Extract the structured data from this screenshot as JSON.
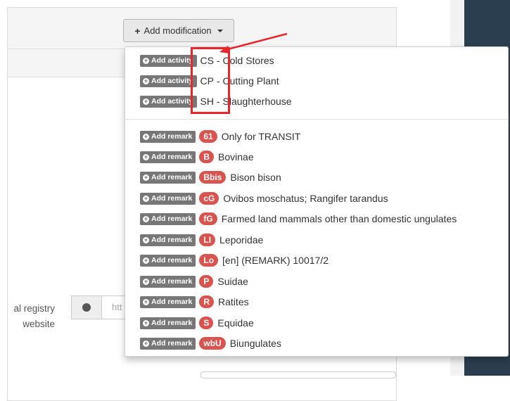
{
  "toolbar": {
    "add_modification_label": "Add modification"
  },
  "activities": [
    {
      "tag": "Add activity",
      "code": "CS",
      "text": "- Cold Stores"
    },
    {
      "tag": "Add activity",
      "code": "CP",
      "text": "- Cutting Plant"
    },
    {
      "tag": "Add activity",
      "code": "SH",
      "text": "- Slaughterhouse"
    }
  ],
  "remarks": [
    {
      "tag": "Add remark",
      "badge": "61",
      "text": "Only for TRANSIT"
    },
    {
      "tag": "Add remark",
      "badge": "B",
      "text": "Bovinae"
    },
    {
      "tag": "Add remark",
      "badge": "Bbis",
      "text": "Bison bison"
    },
    {
      "tag": "Add remark",
      "badge": "cG",
      "text": "Ovibos moschatus; Rangifer tarandus"
    },
    {
      "tag": "Add remark",
      "badge": "fG",
      "text": "Farmed land mammals other than domestic ungulates"
    },
    {
      "tag": "Add remark",
      "badge": "LI",
      "text": "Leporidae"
    },
    {
      "tag": "Add remark",
      "badge": "Lo",
      "text": "[en] (REMARK) 10017/2"
    },
    {
      "tag": "Add remark",
      "badge": "P",
      "text": "Suidae"
    },
    {
      "tag": "Add remark",
      "badge": "R",
      "text": "Ratites"
    },
    {
      "tag": "Add remark",
      "badge": "S",
      "text": "Equidae"
    },
    {
      "tag": "Add remark",
      "badge": "wbU",
      "text": "Biungulates"
    }
  ],
  "registry": {
    "label_line1": "al registry",
    "label_line2": "website",
    "placeholder": "htt"
  },
  "colors": {
    "badge": "#d9534f",
    "tag": "#777777",
    "highlight": "#e8262b",
    "sidebar": "#2b3e4f"
  },
  "icons": {
    "tag": "plus-circle-icon",
    "registry": "globe-icon"
  }
}
